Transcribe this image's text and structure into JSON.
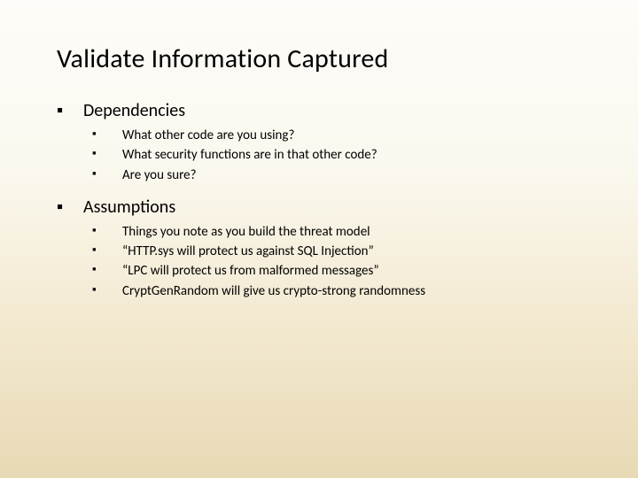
{
  "title": "Validate Information Captured",
  "sections": [
    {
      "heading": "Dependencies",
      "items": [
        "What other code are you using?",
        "What security functions are in that other code?",
        "Are you sure?"
      ]
    },
    {
      "heading": "Assumptions",
      "items": [
        "Things you note as you build the threat model",
        "“HTTP.sys will protect us against SQL Injection”",
        "“LPC will protect us from malformed messages”",
        "CryptGenRandom will give us crypto-strong randomness"
      ]
    }
  ]
}
